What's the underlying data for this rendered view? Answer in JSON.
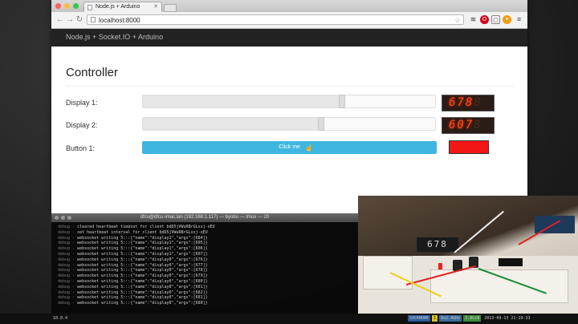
{
  "browser": {
    "tab_title": "Node.js + Arduino",
    "url": "localhost:8000",
    "navbar_brand": "Node.js + Socket.IO + Arduino",
    "light_colors": [
      "#fc605b",
      "#fdbc40",
      "#34c84a"
    ]
  },
  "controller": {
    "title": "Controller",
    "display1": {
      "label": "Display 1:",
      "value": "678",
      "slider_fraction": 0.68
    },
    "display2": {
      "label": "Display 2:",
      "value": "607",
      "slider_fraction": 0.61
    },
    "button1": {
      "label": "Button 1:",
      "button_text": "Click me",
      "indicator_color": "#f21616"
    },
    "accent_color": "#3fb6e0"
  },
  "terminal": {
    "title": "dfcu@dfcu-imac.lan (192.168.1.117) — byobu — tmux — 20",
    "lines": [
      {
        "src": "debug",
        "text": "cleared heartbeat timeout for client bdD5jVWuRBrGLsxj-oEU"
      },
      {
        "src": "debug",
        "text": "set heartbeat interval for client bdD5jVWuRBrGLsxj-oEU"
      },
      {
        "src": "debug",
        "text": "websocket writing 5:::{\"name\":\"display1\",\"args\":[684]}"
      },
      {
        "src": "debug",
        "text": "websocket writing 5:::{\"name\":\"display1\",\"args\":[605]}"
      },
      {
        "src": "debug",
        "text": "websocket writing 5:::{\"name\":\"display1\",\"args\":[606]}"
      },
      {
        "src": "debug",
        "text": "websocket writing 5:::{\"name\":\"display1\",\"args\":[607]}"
      },
      {
        "src": "debug",
        "text": "websocket writing 5:::{\"name\":\"display0\",\"args\":[676]}"
      },
      {
        "src": "debug",
        "text": "websocket writing 5:::{\"name\":\"display0\",\"args\":[677]}"
      },
      {
        "src": "debug",
        "text": "websocket writing 5:::{\"name\":\"display0\",\"args\":[678]}"
      },
      {
        "src": "debug",
        "text": "websocket writing 5:::{\"name\":\"display0\",\"args\":[679]}"
      },
      {
        "src": "debug",
        "text": "websocket writing 5:::{\"name\":\"display0\",\"args\":[680]}"
      },
      {
        "src": "debug",
        "text": "websocket writing 5:::{\"name\":\"display0\",\"args\":[681]}"
      },
      {
        "src": "debug",
        "text": "websocket writing 5:::{\"name\":\"display0\",\"args\":[682]}"
      },
      {
        "src": "debug",
        "text": "websocket writing 5:::{\"name\":\"display0\",\"args\":[681]}"
      },
      {
        "src": "debug",
        "text": "websocket writing 5:::{\"name\":\"display0\",\"args\":[680]}"
      }
    ]
  },
  "statusbar": {
    "left": "10.0.4",
    "right_segments": [
      "SOCKNONE",
      "1",
      "8x2.4GHz",
      "3.8GiB",
      "2013-09-13 21:19:33"
    ]
  },
  "webcam": {
    "display_text": "678"
  }
}
